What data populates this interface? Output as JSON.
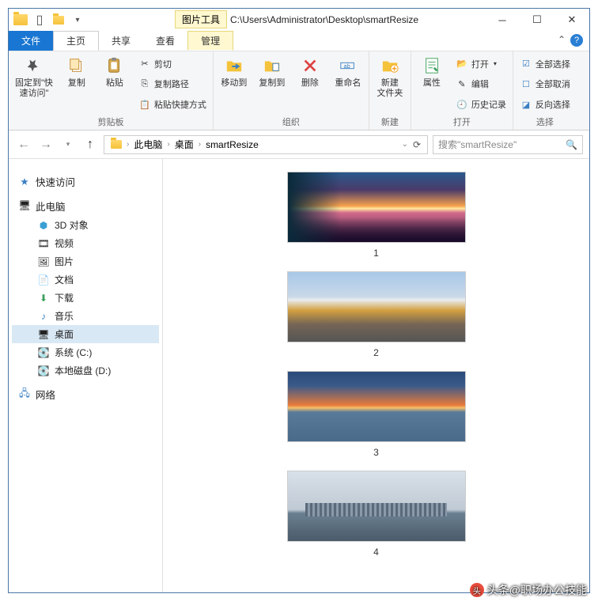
{
  "titlebar": {
    "context_label": "图片工具",
    "path": "C:\\Users\\Administrator\\Desktop\\smartResize"
  },
  "tabs": {
    "file": "文件",
    "home": "主页",
    "share": "共享",
    "view": "查看",
    "manage": "管理"
  },
  "ribbon": {
    "clipboard": {
      "pin": "固定到\"快\n速访问\"",
      "copy": "复制",
      "paste": "粘贴",
      "cut": "剪切",
      "copy_path": "复制路径",
      "paste_shortcut": "粘贴快捷方式",
      "group": "剪贴板"
    },
    "organize": {
      "move_to": "移动到",
      "copy_to": "复制到",
      "delete": "删除",
      "rename": "重命名",
      "group": "组织"
    },
    "new": {
      "new_folder": "新建\n文件夹",
      "group": "新建"
    },
    "open": {
      "properties": "属性",
      "open": "打开",
      "edit": "编辑",
      "history": "历史记录",
      "group": "打开"
    },
    "select": {
      "select_all": "全部选择",
      "select_none": "全部取消",
      "invert": "反向选择",
      "group": "选择"
    }
  },
  "nav": {
    "quick_access": "快速访问",
    "this_pc": "此电脑",
    "objects_3d": "3D 对象",
    "videos": "视频",
    "pictures": "图片",
    "documents": "文档",
    "downloads": "下载",
    "music": "音乐",
    "desktop": "桌面",
    "disk_c": "系统 (C:)",
    "disk_d": "本地磁盘 (D:)",
    "network": "网络"
  },
  "breadcrumb": {
    "this_pc": "此电脑",
    "desktop": "桌面",
    "folder": "smartResize"
  },
  "search": {
    "placeholder": "搜索\"smartResize\""
  },
  "files": [
    {
      "name": "1"
    },
    {
      "name": "2"
    },
    {
      "name": "3"
    },
    {
      "name": "4"
    }
  ],
  "watermark": "头条@职场办公技能"
}
